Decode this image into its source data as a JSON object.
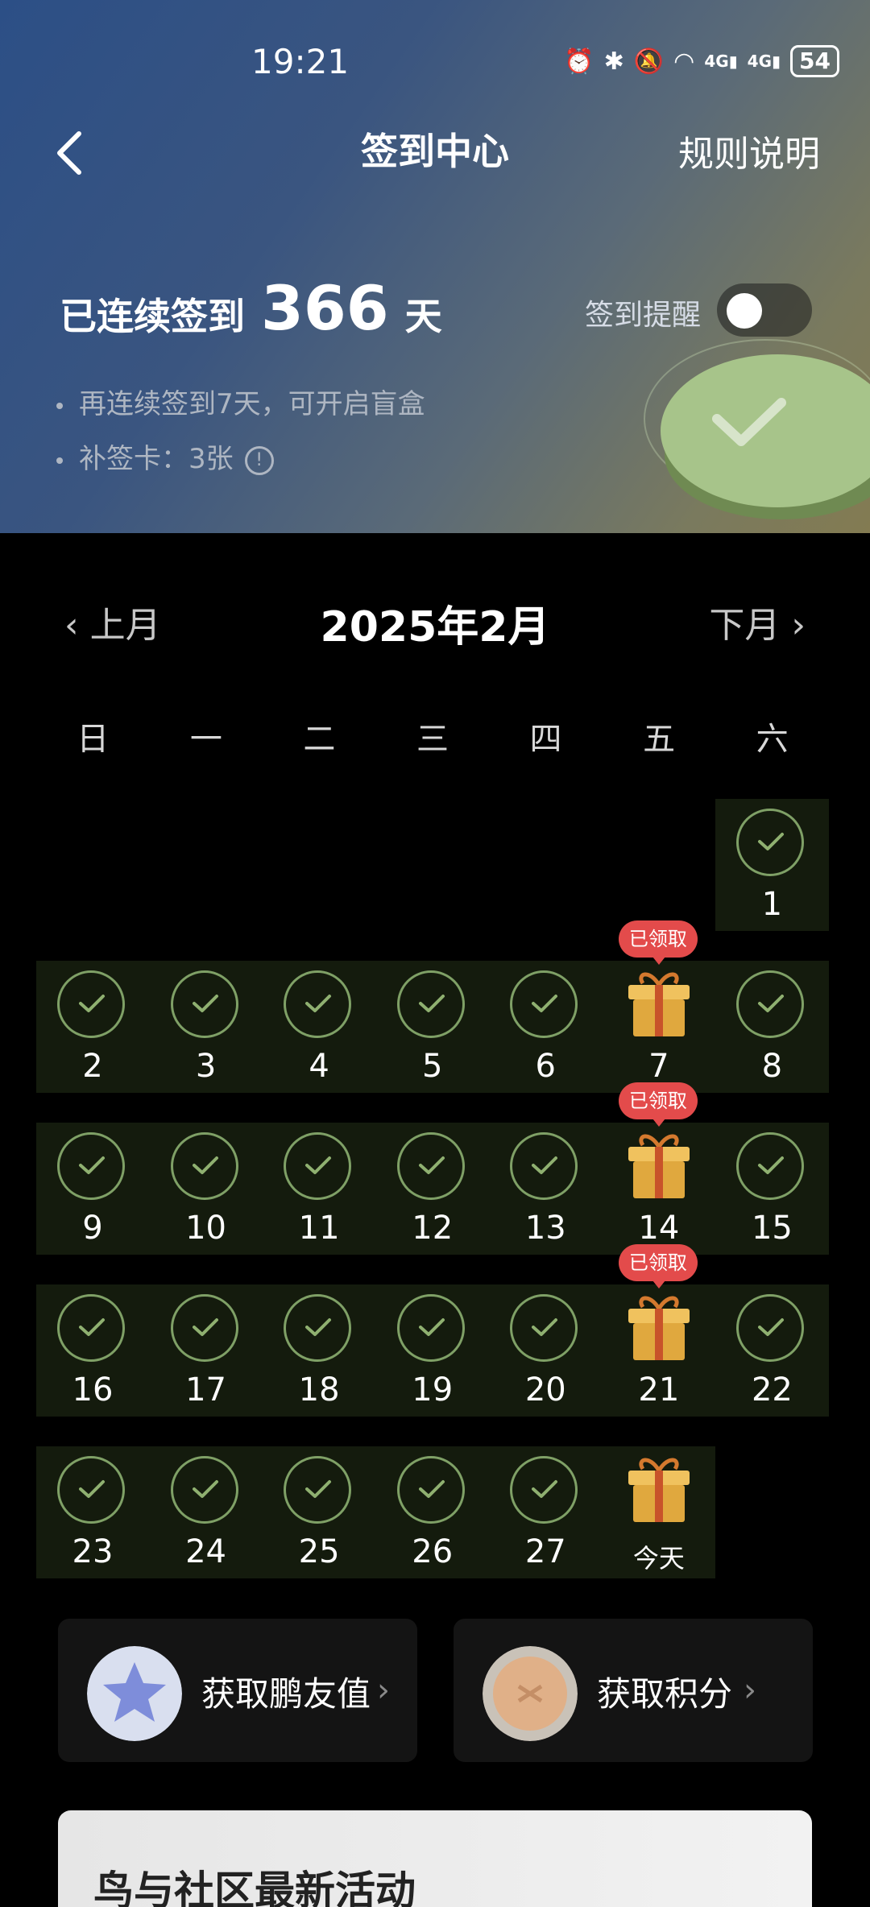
{
  "status_bar": {
    "time": "19:21",
    "signal1": "4G",
    "signal2": "4G",
    "battery": "54"
  },
  "nav": {
    "title": "签到中心",
    "rules": "规则说明"
  },
  "streak": {
    "prefix": "已连续签到",
    "count": "366",
    "suffix": "天"
  },
  "reminder": {
    "label": "签到提醒",
    "enabled": false
  },
  "bullets": [
    "再连续签到7天，可开启盲盒",
    "补签卡：3张"
  ],
  "calendar": {
    "prev": "上月",
    "next": "下月",
    "title": "2025年2月",
    "weekdays": [
      "日",
      "一",
      "二",
      "三",
      "四",
      "五",
      "六"
    ],
    "claimed_label": "已领取",
    "today_label": "今天",
    "days": [
      "1",
      "2",
      "3",
      "4",
      "5",
      "6",
      "7",
      "8",
      "9",
      "10",
      "11",
      "12",
      "13",
      "14",
      "15",
      "16",
      "17",
      "18",
      "19",
      "20",
      "21",
      "22",
      "23",
      "24",
      "25",
      "26",
      "27"
    ]
  },
  "cards": [
    {
      "label": "获取鹏友值",
      "icon": "star-badge-icon"
    },
    {
      "label": "获取积分",
      "icon": "coin-icon"
    }
  ],
  "banner": {
    "text": "鸟与社区最新活动"
  },
  "colors": {
    "accent_green": "#7fa066",
    "claimed_red": "#e34b4b",
    "gift_gold": "#e8b24a"
  }
}
